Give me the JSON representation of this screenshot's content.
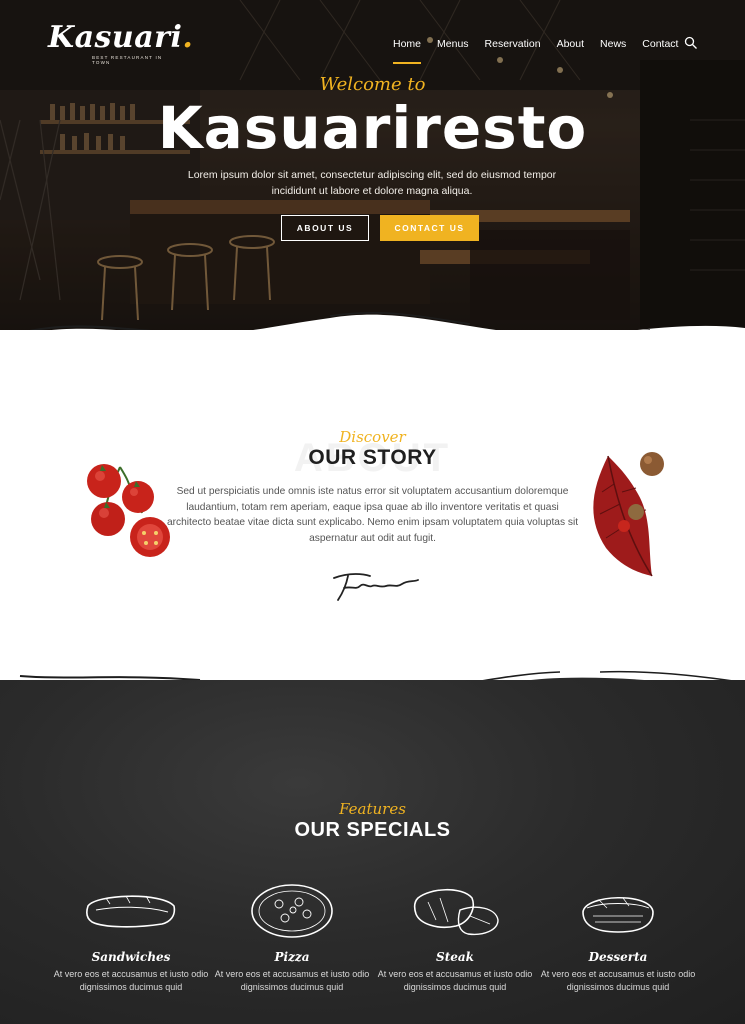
{
  "brand": {
    "name": "Kasuari",
    "dot": ".",
    "tagline": "BEST RESTAURANT IN TOWN"
  },
  "nav": {
    "items": [
      {
        "label": "Home",
        "active": true
      },
      {
        "label": "Menus",
        "active": false
      },
      {
        "label": "Reservation",
        "active": false
      },
      {
        "label": "About",
        "active": false
      },
      {
        "label": "News",
        "active": false
      },
      {
        "label": "Contact",
        "active": false
      }
    ],
    "search_icon": "search-icon"
  },
  "hero": {
    "welcome": "Welcome to",
    "title": "Kasuariresto",
    "text": "Lorem ipsum dolor sit amet, consectetur adipiscing elit, sed do eiusmod tempor incididunt ut labore et dolore magna aliqua.",
    "about_button": "ABOUT US",
    "contact_button": "CONTACT US"
  },
  "story": {
    "kicker": "Discover",
    "bg_word": "ABOUT",
    "title": "OUR STORY",
    "text": "Sed ut perspiciatis unde omnis iste natus error sit voluptatem accusantium doloremque laudantium, totam rem aperiam, eaque ipsa quae ab illo inventore veritatis et quasi architecto beatae vitae dicta sunt explicabo. Nemo enim ipsam voluptatem quia voluptas sit aspernatur aut odit aut fugit."
  },
  "specials": {
    "kicker": "Features",
    "title": "OUR SPECIALS",
    "items": [
      {
        "name": "Sandwiches",
        "desc": "At vero eos et accusamus et iusto odio dignissimos ducimus quid"
      },
      {
        "name": "Pizza",
        "desc": "At vero eos et accusamus et iusto odio dignissimos ducimus quid"
      },
      {
        "name": "Steak",
        "desc": "At vero eos et accusamus et iusto odio dignissimos ducimus quid"
      },
      {
        "name": "Desserta",
        "desc": "At vero eos et accusamus et iusto odio dignissimos ducimus quid"
      }
    ]
  },
  "colors": {
    "accent": "#f0b321",
    "dark": "#2b2b2b",
    "text": "#555555"
  }
}
